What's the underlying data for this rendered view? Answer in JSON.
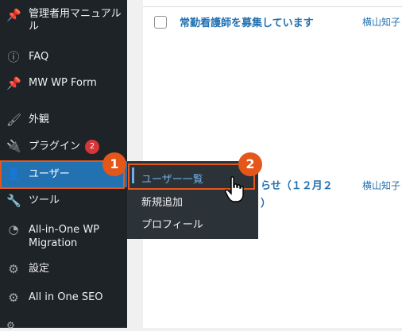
{
  "sidebar": {
    "items": [
      {
        "icon": "pin-icon",
        "label": "管理者用マニュアル\nル"
      },
      {
        "icon": "info-icon",
        "label": "FAQ"
      },
      {
        "icon": "pin-icon",
        "label": "MW WP Form"
      },
      {
        "icon": "brush-icon",
        "label": "外観"
      },
      {
        "icon": "plugin-icon",
        "label": "プラグイン",
        "badge": "2"
      },
      {
        "icon": "user-icon",
        "label": "ユーザー"
      },
      {
        "icon": "wrench-icon",
        "label": "ツール"
      },
      {
        "icon": "migration-icon",
        "label": "All-in-One WP\nMigration"
      },
      {
        "icon": "settings-icon",
        "label": "設定"
      },
      {
        "icon": "gear-icon",
        "label": "All in One SEO"
      }
    ]
  },
  "submenu": {
    "items": [
      {
        "label": "ユーザー一覧"
      },
      {
        "label": "新規追加"
      },
      {
        "label": "プロフィール"
      }
    ]
  },
  "callouts": {
    "first": "1",
    "second": "2"
  },
  "posts": {
    "rows": [
      {
        "title": "常勤看護師を募集しています",
        "author": "横山知子"
      },
      {
        "title": "らせ（１２月２\n）",
        "author": "横山知子"
      }
    ]
  },
  "colors": {
    "sidebar": "#1d2327",
    "accent": "#2271b1",
    "highlight": "#e4571b",
    "badge": "#d63638"
  }
}
